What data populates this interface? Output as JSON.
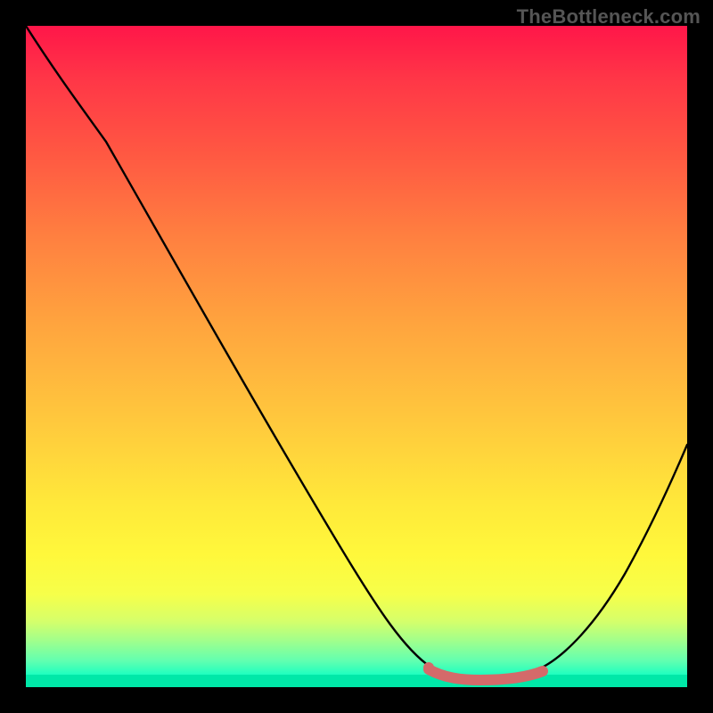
{
  "watermark": "TheBottleneck.com",
  "chart_data": {
    "type": "line",
    "title": "",
    "xlabel": "",
    "ylabel": "",
    "xlim": [
      0,
      100
    ],
    "ylim": [
      0,
      100
    ],
    "grid": false,
    "legend": false,
    "series": [
      {
        "name": "bottleneck-curve",
        "x": [
          0,
          6,
          12,
          18,
          24,
          30,
          36,
          42,
          48,
          54,
          58,
          62,
          66,
          70,
          74,
          78,
          82,
          86,
          90,
          94,
          98,
          100
        ],
        "values": [
          100,
          94,
          87,
          79,
          70,
          61,
          52,
          43,
          34,
          24,
          17,
          11,
          6,
          3,
          1,
          1,
          3,
          8,
          16,
          26,
          38,
          45
        ]
      }
    ],
    "highlight": {
      "name": "optimal-range",
      "x": [
        61,
        64,
        68,
        72,
        76,
        79
      ],
      "values": [
        2,
        1,
        1,
        1,
        1,
        2
      ]
    },
    "colors": {
      "gradient_top": "#ff1649",
      "gradient_bottom": "#00ffc3",
      "curve": "#000000",
      "highlight": "#d46a6a",
      "frame": "#000000"
    }
  }
}
